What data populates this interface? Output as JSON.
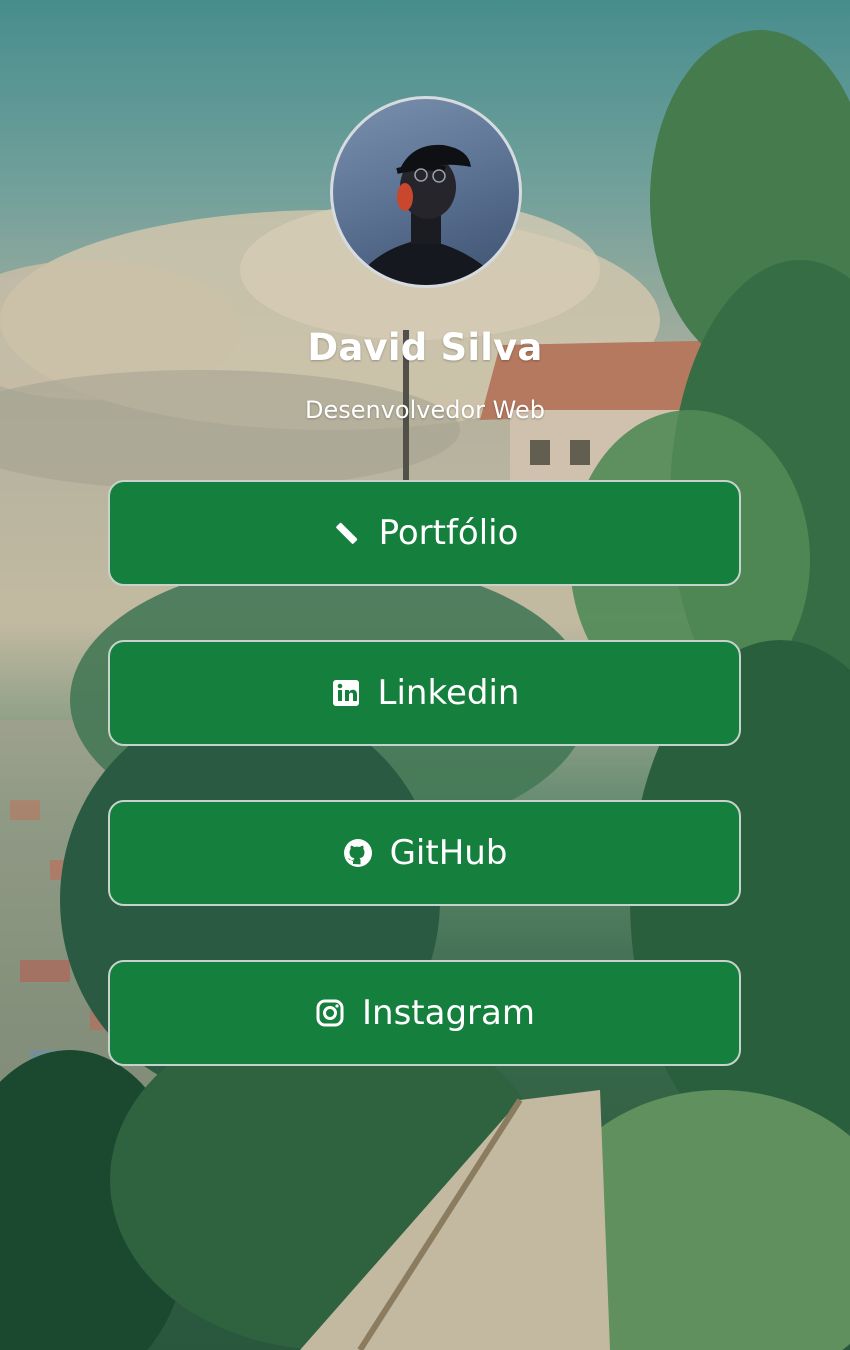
{
  "profile": {
    "name": "David Silva",
    "role": "Desenvolvedor Web"
  },
  "links": [
    {
      "label": "Portfólio",
      "icon": "pencil-ruler-icon"
    },
    {
      "label": "Linkedin",
      "icon": "linkedin-icon"
    },
    {
      "label": "GitHub",
      "icon": "github-icon"
    },
    {
      "label": "Instagram",
      "icon": "instagram-icon"
    }
  ],
  "colors": {
    "button_bg": "#15803d",
    "button_border": "#c8d2cc",
    "text": "#ffffff"
  }
}
